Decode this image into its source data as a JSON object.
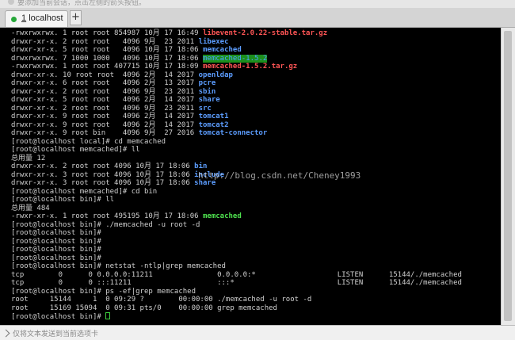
{
  "top_hint": "要添加当前会话，点击左侧的箭头按钮。",
  "tab": {
    "number": "1",
    "label": "localhost"
  },
  "new_tab_label": "+",
  "watermark": "http://blog.csdn.net/Cheney1993",
  "bottom_placeholder": "仅将文本发送到当前选项卡",
  "colors": {
    "directory": "#5c9dff",
    "archive": "#ff5555",
    "executable": "#4ee04e",
    "highlight_bg": "#1c8f1c"
  },
  "terminal_lines": [
    [
      {
        "t": "-rwxrwxrwx. 1 root root 854987 10月 17 16:49 "
      },
      {
        "t": "libevent-2.0.22-stable.tar.gz",
        "c": "red"
      }
    ],
    [
      {
        "t": "drwxr-xr-x. 2 root root   4096 9月  23 2011 "
      },
      {
        "t": "libexec",
        "c": "blue"
      }
    ],
    [
      {
        "t": "drwxr-xr-x. 5 root root   4096 10月 17 18:06 "
      },
      {
        "t": "memcached",
        "c": "blue"
      }
    ],
    [
      {
        "t": "drwxrwxrwx. 7 1000 1000   4096 10月 17 18:06 "
      },
      {
        "t": "memcached-1.5.2",
        "c": "hl"
      }
    ],
    [
      {
        "t": "-rwxrwxrwx. 1 root root 407715 10月 17 18:09 "
      },
      {
        "t": "memcached-1.5.2.tar.gz",
        "c": "red"
      }
    ],
    [
      {
        "t": "drwxr-xr-x. 10 root root  4096 2月  14 2017 "
      },
      {
        "t": "openldap",
        "c": "blue"
      }
    ],
    [
      {
        "t": "drwxr-xr-x. 6 root root   4096 2月  13 2017 "
      },
      {
        "t": "pcre",
        "c": "blue"
      }
    ],
    [
      {
        "t": "drwxr-xr-x. 2 root root   4096 9月  23 2011 "
      },
      {
        "t": "sbin",
        "c": "blue"
      }
    ],
    [
      {
        "t": "drwxr-xr-x. 5 root root   4096 2月  14 2017 "
      },
      {
        "t": "share",
        "c": "blue"
      }
    ],
    [
      {
        "t": "drwxr-xr-x. 2 root root   4096 9月  23 2011 "
      },
      {
        "t": "src",
        "c": "blue"
      }
    ],
    [
      {
        "t": "drwxr-xr-x. 9 root root   4096 2月  14 2017 "
      },
      {
        "t": "tomcat1",
        "c": "blue"
      }
    ],
    [
      {
        "t": "drwxr-xr-x. 9 root root   4096 2月  14 2017 "
      },
      {
        "t": "tomcat2",
        "c": "blue"
      }
    ],
    [
      {
        "t": "drwxr-xr-x. 9 root bin    4096 9月  27 2016 "
      },
      {
        "t": "tomcat-connector",
        "c": "blue"
      }
    ],
    [
      {
        "t": "[root@localhost local]# cd memcached"
      }
    ],
    [
      {
        "t": "[root@localhost memcached]# ll"
      }
    ],
    [
      {
        "t": "总用量 12"
      }
    ],
    [
      {
        "t": "drwxr-xr-x. 2 root root 4096 10月 17 18:06 "
      },
      {
        "t": "bin",
        "c": "blue"
      }
    ],
    [
      {
        "t": "drwxr-xr-x. 3 root root 4096 10月 17 18:06 "
      },
      {
        "t": "include",
        "c": "blue"
      }
    ],
    [
      {
        "t": "drwxr-xr-x. 3 root root 4096 10月 17 18:06 "
      },
      {
        "t": "share",
        "c": "blue"
      }
    ],
    [
      {
        "t": "[root@localhost memcached]# cd bin"
      }
    ],
    [
      {
        "t": "[root@localhost bin]# ll"
      }
    ],
    [
      {
        "t": "总用量 484"
      }
    ],
    [
      {
        "t": "-rwxr-xr-x. 1 root root 495195 10月 17 18:06 "
      },
      {
        "t": "memcached",
        "c": "green"
      }
    ],
    [
      {
        "t": "[root@localhost bin]# ./memcached -u root -d"
      }
    ],
    [
      {
        "t": "[root@localhost bin]#"
      }
    ],
    [
      {
        "t": "[root@localhost bin]#"
      }
    ],
    [
      {
        "t": "[root@localhost bin]#"
      }
    ],
    [
      {
        "t": "[root@localhost bin]#"
      }
    ],
    [
      {
        "t": "[root@localhost bin]# netstat -ntlp|grep memcached"
      }
    ],
    [
      {
        "t": "tcp        0      0 0.0.0.0:11211               0.0.0.0:*                   LISTEN      15144/./memcached"
      }
    ],
    [
      {
        "t": "tcp        0      0 :::11211                    :::*                        LISTEN      15144/./memcached"
      }
    ],
    [
      {
        "t": "[root@localhost bin]# ps -ef|grep memcached"
      }
    ],
    [
      {
        "t": "root     15144     1  0 09:29 ?        00:00:00 ./memcached -u root -d"
      }
    ],
    [
      {
        "t": "root     15169 15094  0 09:31 pts/0    00:00:00 grep memcached"
      }
    ],
    [
      {
        "t": "[root@localhost bin]# "
      },
      {
        "cursor": true
      }
    ]
  ]
}
